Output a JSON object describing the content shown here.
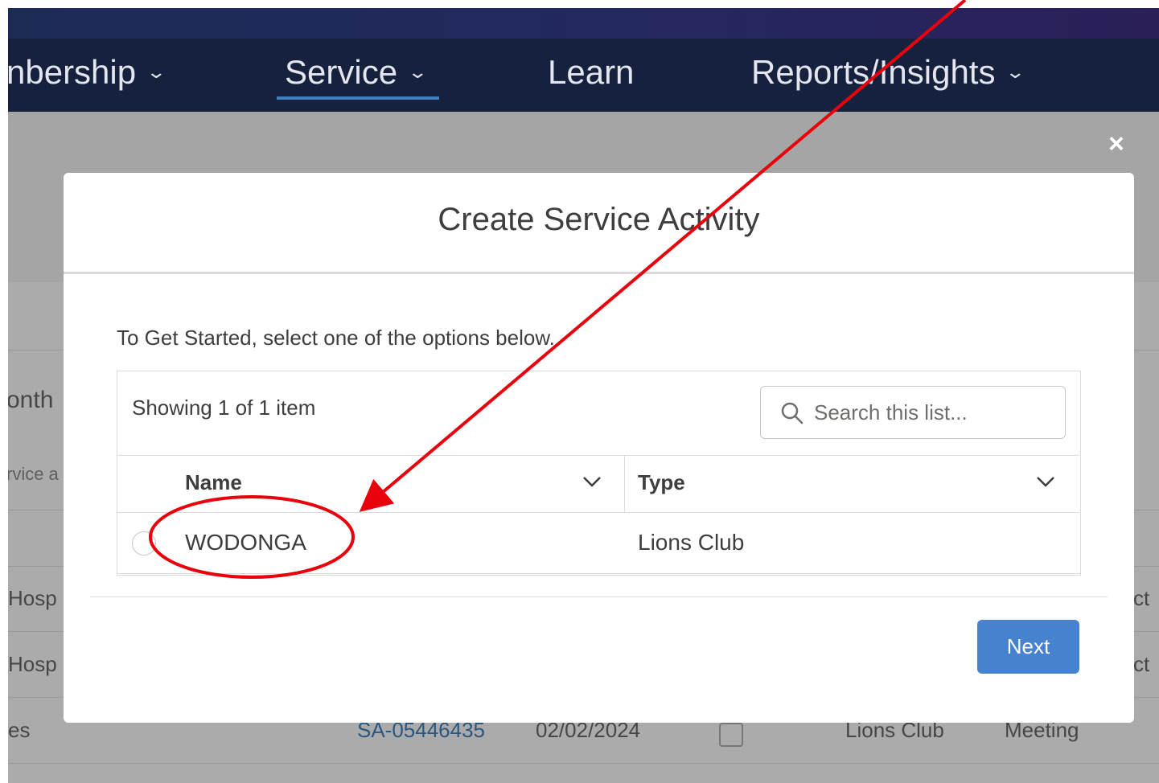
{
  "nav": {
    "items": [
      {
        "label": "nbership",
        "has_chevron": true
      },
      {
        "label": "Service",
        "has_chevron": true,
        "active": true
      },
      {
        "label": "Learn",
        "has_chevron": false
      },
      {
        "label": "Reports/Insights",
        "has_chevron": true
      }
    ],
    "chevron": "⌄"
  },
  "background": {
    "heading_fragment": "onth",
    "subtext_fragment": "rvice a",
    "rows": [
      {
        "left": "Hosp",
        "right": "ct"
      },
      {
        "left": "Hosp",
        "right": "ct"
      },
      {
        "left": "es",
        "id": "SA-05446435",
        "date": "02/02/2024",
        "type": "Lions Club",
        "category": "Meeting"
      }
    ]
  },
  "modal": {
    "close_symbol": "×",
    "title": "Create Service Activity",
    "instruction": "To Get Started, select one of the options below.",
    "list_count": "Showing 1 of 1 item",
    "search_placeholder": "Search this list...",
    "columns": [
      "Name",
      "Type"
    ],
    "rows": [
      {
        "name": "WODONGA",
        "type": "Lions Club"
      }
    ],
    "next_label": "Next"
  },
  "colors": {
    "navbar": "#16213d",
    "accent": "#3f7fbf",
    "button": "#4782cf",
    "annotation": "#e8000b"
  }
}
